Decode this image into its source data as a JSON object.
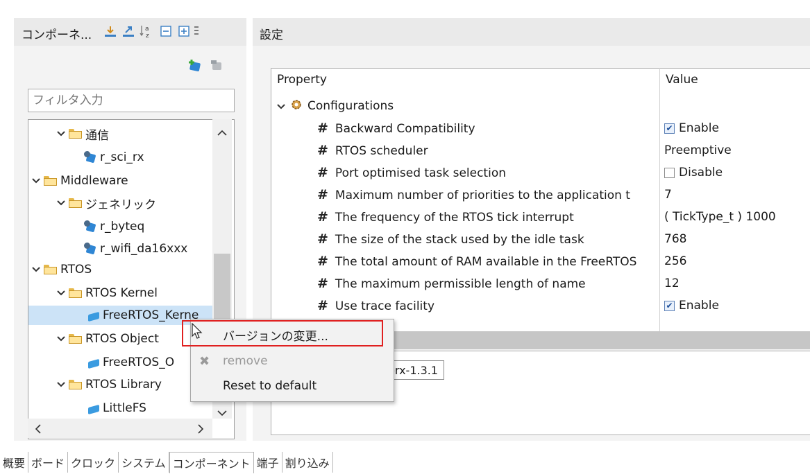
{
  "component_panel": {
    "title": "コンポーネ...",
    "toolbar_icons": [
      "import-icon",
      "export-icon",
      "sort-az-icon",
      "collapse-all-icon",
      "expand-all-icon",
      "more-icon"
    ],
    "add_icon": "add-component-icon",
    "remove_icon": "remove-component-icon",
    "filter_placeholder": "フィルタ入力",
    "tree": [
      {
        "label": "通信",
        "type": "folder"
      },
      {
        "label": "r_sci_rx",
        "type": "component"
      },
      {
        "label": "Middleware",
        "type": "folder"
      },
      {
        "label": "ジェネリック",
        "type": "folder"
      },
      {
        "label": "r_byteq",
        "type": "component"
      },
      {
        "label": "r_wifi_da16xxx",
        "type": "component"
      },
      {
        "label": "RTOS",
        "type": "folder"
      },
      {
        "label": "RTOS Kernel",
        "type": "folder"
      },
      {
        "label": "FreeRTOS_Kerne",
        "type": "component",
        "selected": true
      },
      {
        "label": "RTOS Object",
        "type": "folder"
      },
      {
        "label": "FreeRTOS_O",
        "type": "component"
      },
      {
        "label": "RTOS Library",
        "type": "folder"
      },
      {
        "label": "LittleFS",
        "type": "component"
      }
    ]
  },
  "settings_panel": {
    "title": "設定",
    "col_property": "Property",
    "col_value": "Value",
    "group": "Configurations",
    "rows": [
      {
        "property": "Backward Compatibility",
        "value": "Enable",
        "checkbox": true,
        "checked": true
      },
      {
        "property": "RTOS scheduler",
        "value": "Preemptive"
      },
      {
        "property": "Port optimised task selection",
        "value": "Disable",
        "checkbox": true,
        "checked": false
      },
      {
        "property": "Maximum number of priorities to the application t",
        "value": "7"
      },
      {
        "property": "The frequency of the RTOS tick interrupt",
        "value": "( TickType_t ) 1000"
      },
      {
        "property": "The size of the stack used by the idle task",
        "value": "768"
      },
      {
        "property": "The total amount of RAM available in the FreeRTOS",
        "value": "256"
      },
      {
        "property": "The maximum permissible length of name",
        "value": "12"
      },
      {
        "property": "Use trace facility",
        "value": "Enable",
        "checkbox": true,
        "checked": true
      }
    ],
    "version_tooltip": "S-rx-1.3.1"
  },
  "context_menu": {
    "change_version": "バージョンの変更...",
    "remove": "remove",
    "reset": "Reset to default"
  },
  "bottom_tabs": [
    "概要",
    "ボード",
    "クロック",
    "システム",
    "コンポーネント",
    "端子",
    "割り込み"
  ],
  "active_tab": "コンポーネント",
  "colors": {
    "highlight_border": "#e02020",
    "selection": "#cce3f7"
  }
}
